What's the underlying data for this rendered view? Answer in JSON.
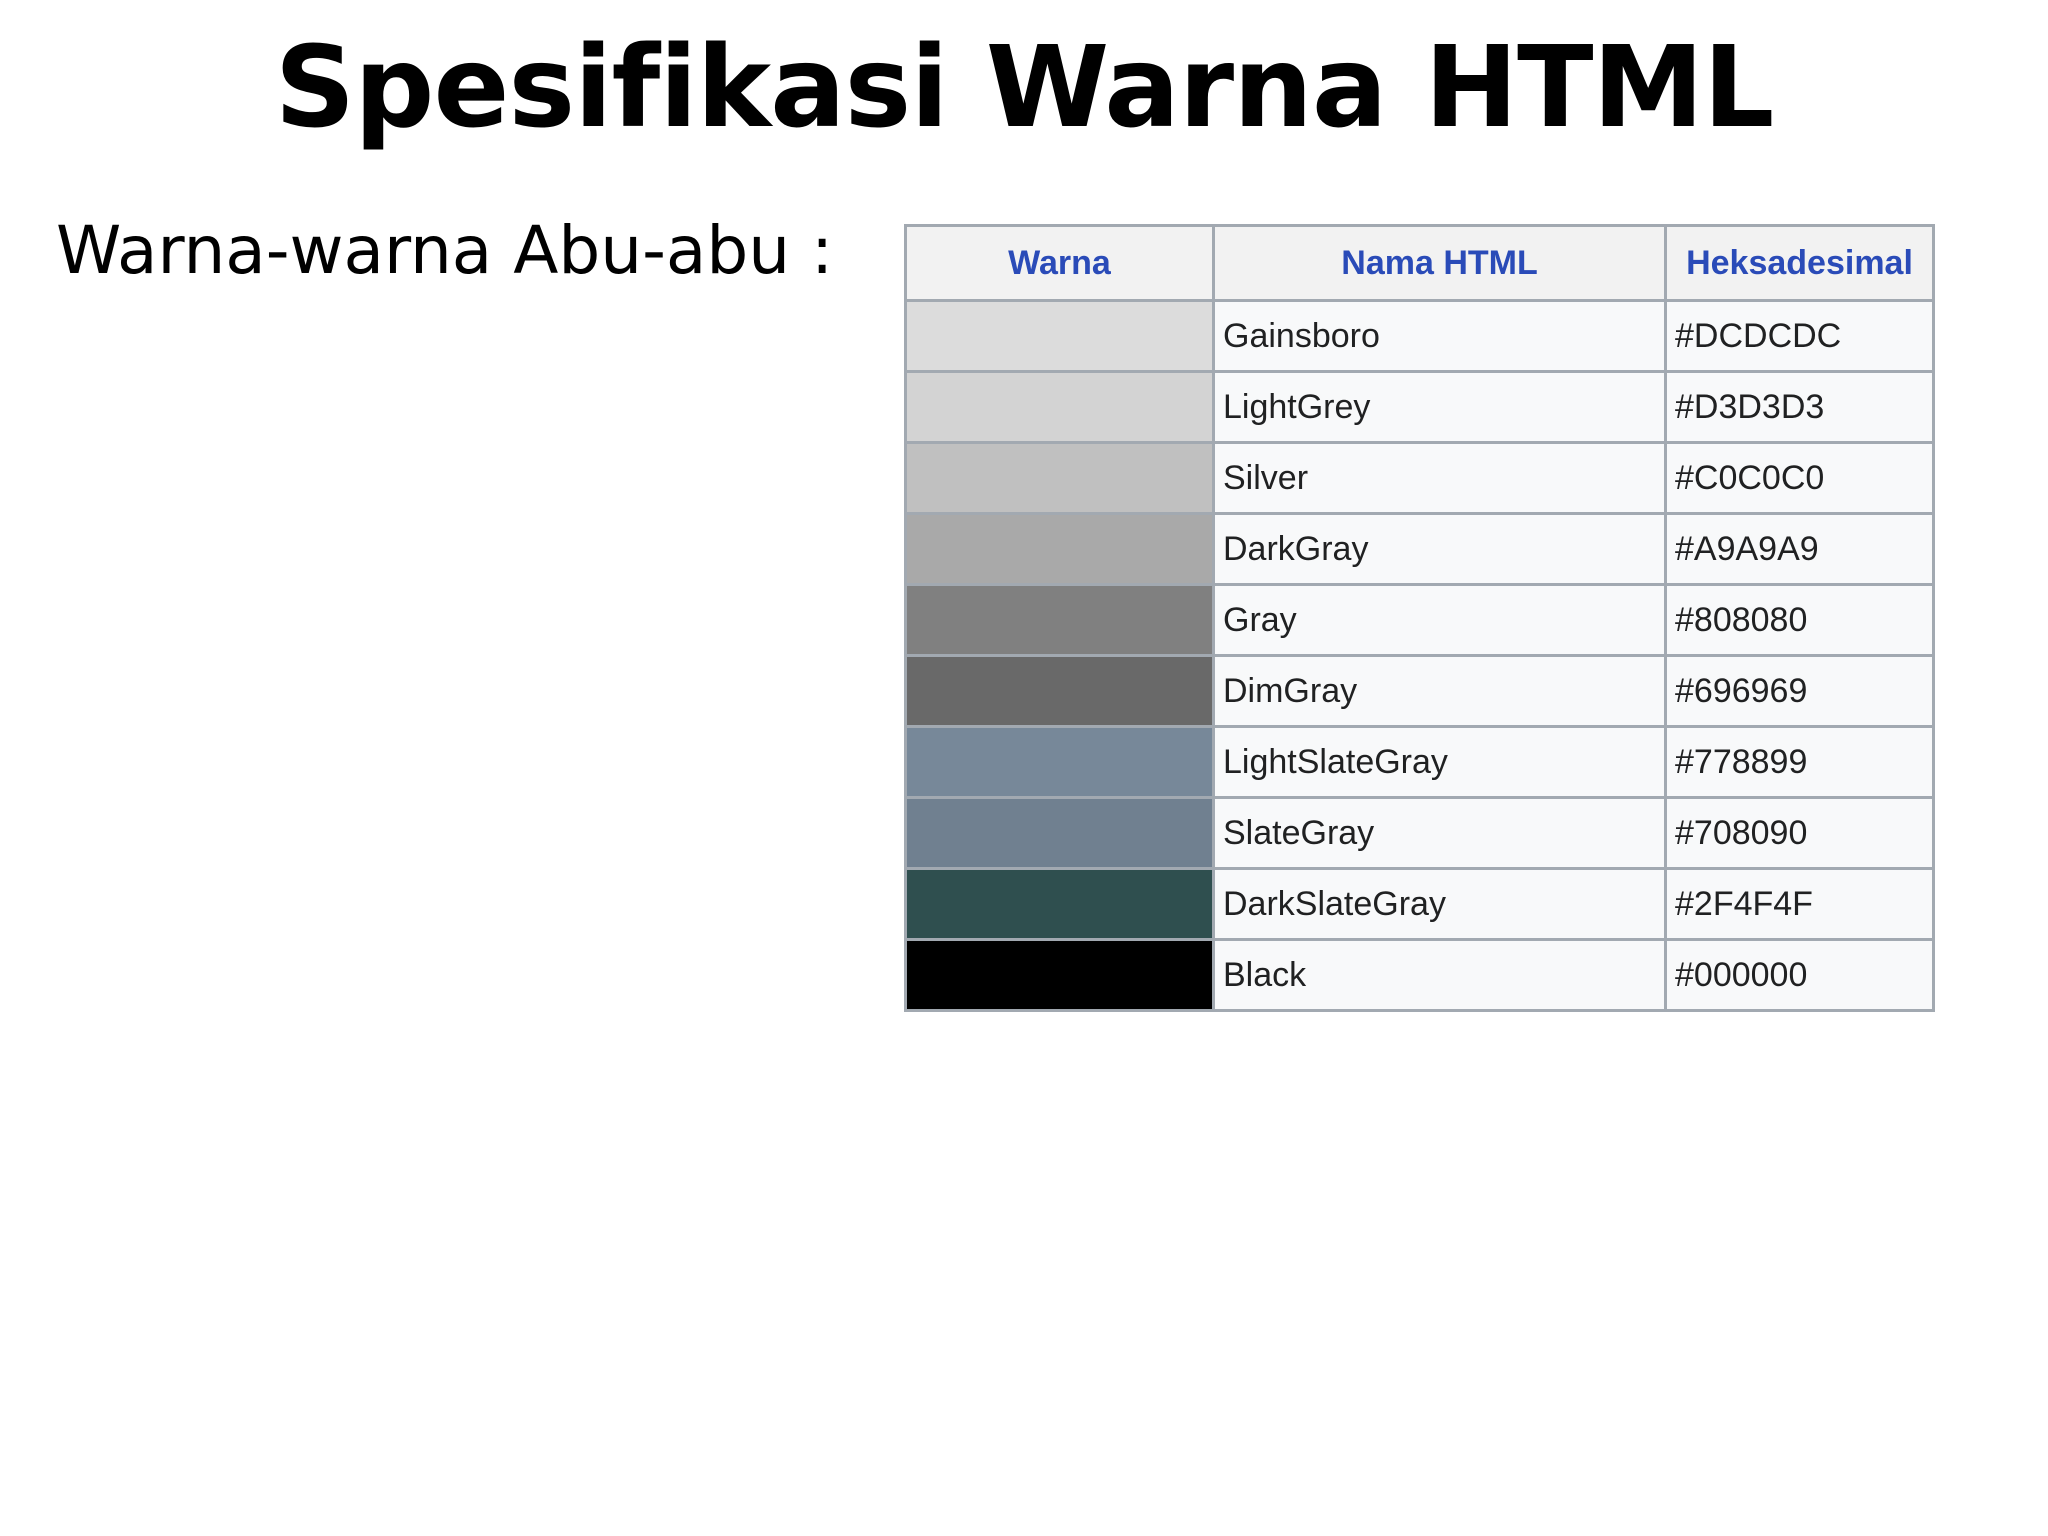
{
  "title": "Spesifikasi Warna HTML",
  "subtitle": "Warna-warna Abu-abu :",
  "table": {
    "headers": [
      "Warna",
      "Nama HTML",
      "Heksadesimal"
    ],
    "rows": [
      {
        "name": "Gainsboro",
        "hex": "#DCDCDC",
        "swatch": "#DCDCDC"
      },
      {
        "name": "LightGrey",
        "hex": "#D3D3D3",
        "swatch": "#D3D3D3"
      },
      {
        "name": "Silver",
        "hex": "#C0C0C0",
        "swatch": "#C0C0C0"
      },
      {
        "name": "DarkGray",
        "hex": "#A9A9A9",
        "swatch": "#A9A9A9"
      },
      {
        "name": "Gray",
        "hex": "#808080",
        "swatch": "#808080"
      },
      {
        "name": "DimGray",
        "hex": "#696969",
        "swatch": "#696969"
      },
      {
        "name": "LightSlateGray",
        "hex": "#778899",
        "swatch": "#778899"
      },
      {
        "name": "SlateGray",
        "hex": "#708090",
        "swatch": "#708090"
      },
      {
        "name": "DarkSlateGray",
        "hex": "#2F4F4F",
        "swatch": "#2F4F4F"
      },
      {
        "name": "Black",
        "hex": "#000000",
        "swatch": "#000000"
      }
    ]
  }
}
